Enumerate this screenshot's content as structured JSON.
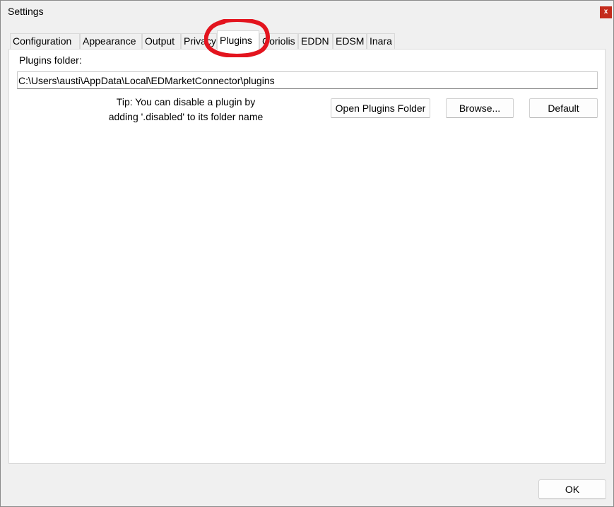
{
  "window": {
    "title": "Settings",
    "close_glyph": "x"
  },
  "tabs": [
    {
      "label": "Configuration",
      "active": false
    },
    {
      "label": "Appearance",
      "active": false
    },
    {
      "label": "Output",
      "active": false
    },
    {
      "label": "Privacy",
      "active": false
    },
    {
      "label": "Plugins",
      "active": true
    },
    {
      "label": "Coriolis",
      "active": false
    },
    {
      "label": "EDDN",
      "active": false
    },
    {
      "label": "EDSM",
      "active": false
    },
    {
      "label": "Inara",
      "active": false
    }
  ],
  "plugins": {
    "folder_label": "Plugins folder:",
    "folder_path": "C:\\Users\\austi\\AppData\\Local\\EDMarketConnector\\plugins",
    "tip_line1": "Tip: You can disable a plugin by",
    "tip_line2": "adding '.disabled' to its folder name",
    "open_folder_label": "Open Plugins Folder",
    "browse_label": "Browse...",
    "default_label": "Default"
  },
  "footer": {
    "ok_label": "OK"
  },
  "colors": {
    "close_button": "#c42b1c",
    "annotation": "#e3141e",
    "window_background": "#f0f0f0"
  }
}
